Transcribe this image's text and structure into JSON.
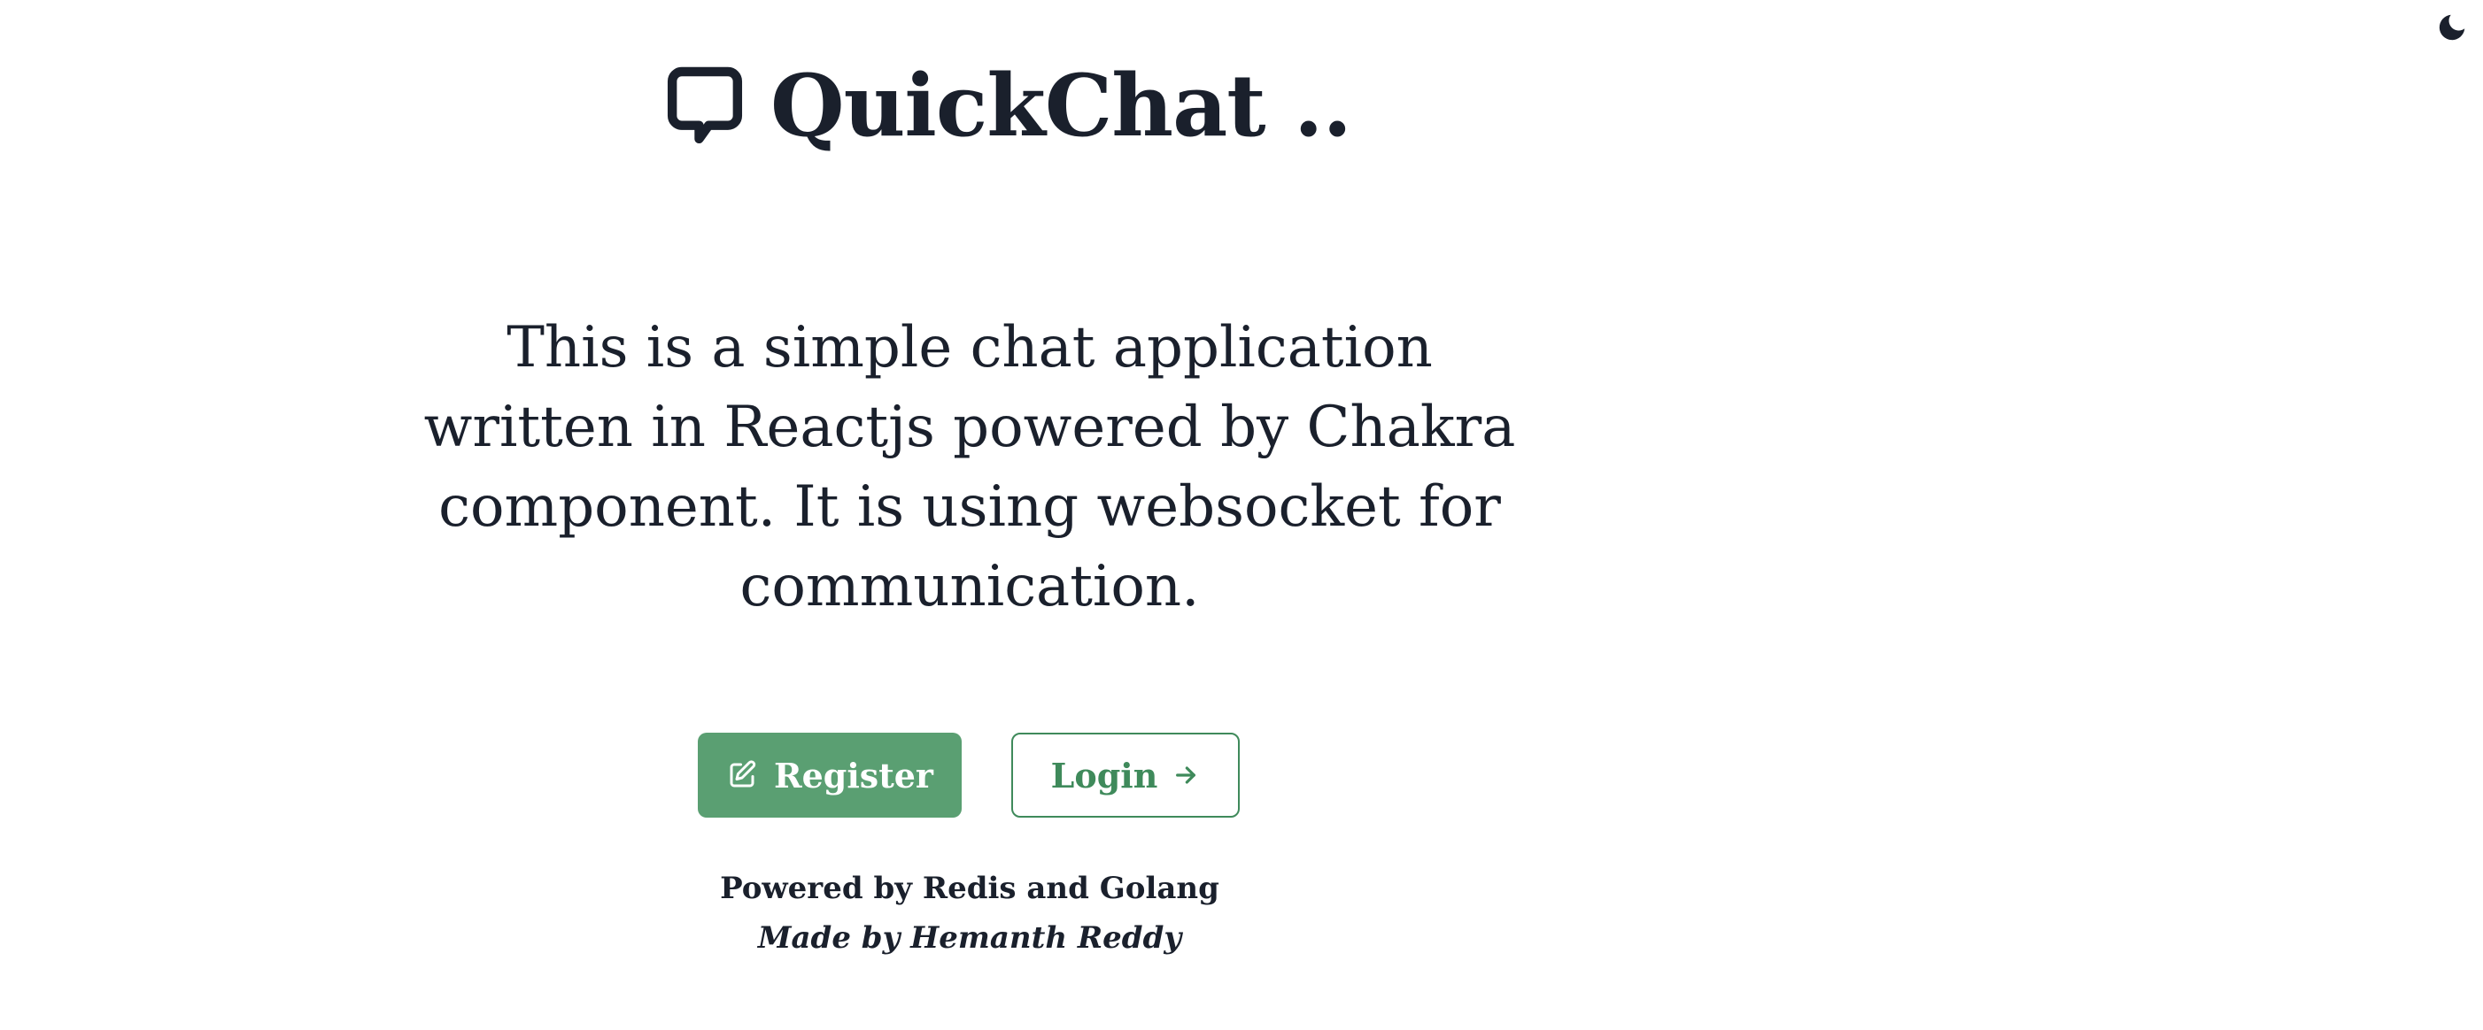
{
  "app": {
    "title": "QuickChat ..",
    "title_icon": "chat-bubble-icon"
  },
  "theme_toggle": {
    "icon": "moon-icon"
  },
  "description": "This is a simple chat application written in Reactjs powered by Chakra component. It is using websocket for communication.",
  "buttons": {
    "register_label": "Register",
    "register_icon": "edit-icon",
    "login_label": "Login",
    "login_icon": "arrow-right-icon"
  },
  "footer": {
    "powered_by": "Powered by Redis and Golang",
    "made_by": "Made by Hemanth Reddy"
  },
  "colors": {
    "text": "#1a202c",
    "register_bg": "#5a9f72",
    "login_border": "#3f8a5b"
  }
}
